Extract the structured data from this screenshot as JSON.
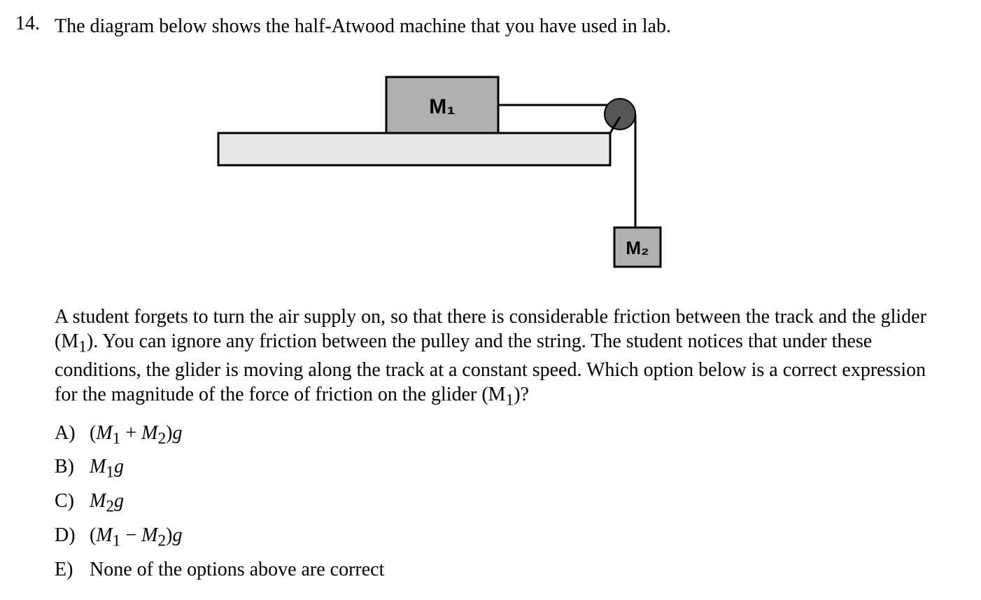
{
  "question": {
    "number": "14.",
    "stem": "The diagram below shows the half-Atwood machine that you have used in lab.",
    "body_html": "A student forgets to turn the air supply on, so that there is considerable friction between the track and the glider (M<sub>1</sub>). You can ignore any friction between the pulley and the string. The student notices that under these conditions, the glider is moving along the track at a constant speed. Which option below is a correct expression for the magnitude of the force of friction on the glider (M<sub>1</sub>)?",
    "options": [
      {
        "label": "A)",
        "expr_html": "(<i>M</i><sub>1</sub> + <i>M</i><sub>2</sub>)<i>g</i>"
      },
      {
        "label": "B)",
        "expr_html": "<i>M</i><sub>1</sub><i>g</i>"
      },
      {
        "label": "C)",
        "expr_html": "<i>M</i><sub>2</sub><i>g</i>"
      },
      {
        "label": "D)",
        "expr_html": "(<i>M</i><sub>1</sub> − <i>M</i><sub>2</sub>)<i>g</i>"
      },
      {
        "label": "E)",
        "expr_html": "None of the options above are correct"
      }
    ]
  },
  "diagram": {
    "labels": {
      "m1": "M₁",
      "m2": "M₂"
    },
    "colors": {
      "block_fill": "#b0b0b0",
      "track_fill": "#e8e8e8",
      "stroke": "#000000",
      "pulley_fill": "#555555"
    }
  }
}
